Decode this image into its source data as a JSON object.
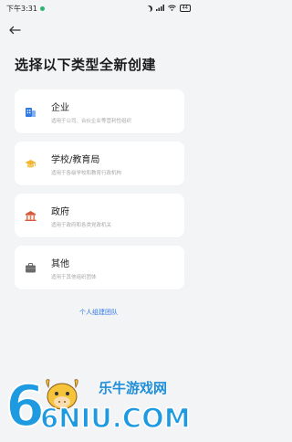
{
  "status": {
    "time": "下午3:31",
    "battery": "44"
  },
  "page": {
    "title": "选择以下类型全新创建"
  },
  "cards": [
    {
      "title": "企业",
      "desc": "适用于公司、合伙企业等营利性组织",
      "icon": "building-icon",
      "color": "#2f78e6"
    },
    {
      "title": "学校/教育局",
      "desc": "适用于各级学校和教育行政机构",
      "icon": "graduation-cap-icon",
      "color": "#f2b634"
    },
    {
      "title": "政府",
      "desc": "适用于政府和各类党政机关",
      "icon": "government-building-icon",
      "color": "#d65a3a"
    },
    {
      "title": "其他",
      "desc": "适用于其他组织团体",
      "icon": "briefcase-icon",
      "color": "#6b6b6b"
    }
  ],
  "link": {
    "team": "个人组建团队"
  },
  "watermark": {
    "brand": "乐牛游戏网",
    "domain": "6NIU.COM"
  }
}
